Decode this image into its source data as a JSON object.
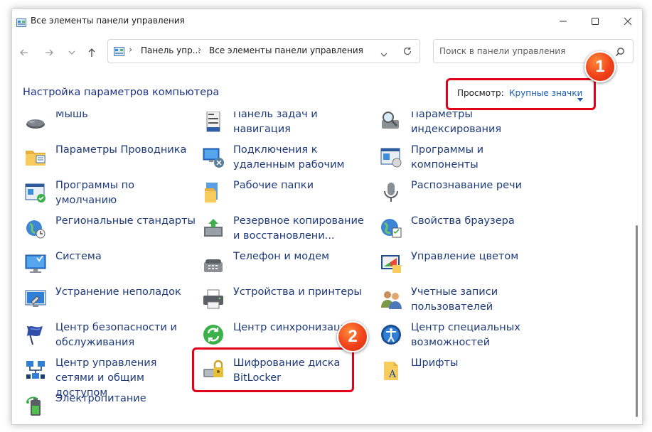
{
  "window": {
    "title": "Все элементы панели управления"
  },
  "address_bar": {
    "segments": [
      "Панель упр...",
      "Все элементы панели управления"
    ]
  },
  "search": {
    "placeholder": "Поиск в панели управления"
  },
  "header": {
    "title": "Настройка параметров компьютера",
    "view_label": "Просмотр:",
    "view_value": "Крупные значки"
  },
  "items": {
    "col1": [
      {
        "label": "Мышь",
        "icon": "mouse-icon"
      },
      {
        "label": "Параметры Проводника",
        "icon": "folder-options-icon"
      },
      {
        "label": "Программы по умолчанию",
        "icon": "default-programs-icon"
      },
      {
        "label": "Региональные стандарты",
        "icon": "region-globe-icon"
      },
      {
        "label": "Система",
        "icon": "system-monitor-icon"
      },
      {
        "label": "Устранение неполадок",
        "icon": "troubleshooting-icon"
      },
      {
        "label": "Центр безопасности и обслуживания",
        "icon": "security-flag-icon"
      },
      {
        "label": "Центр управления сетями и общим доступом",
        "icon": "network-icon"
      },
      {
        "label": "Электропитание",
        "icon": "power-battery-icon"
      }
    ],
    "col2": [
      {
        "label": "Панель задач и навигация",
        "icon": "taskbar-icon"
      },
      {
        "label": "Подключения к удаленным рабочим",
        "icon": "remote-desktop-icon"
      },
      {
        "label": "Рабочие папки",
        "icon": "work-folders-icon"
      },
      {
        "label": "Резервное копирование и восстановлени...",
        "icon": "backup-restore-icon"
      },
      {
        "label": "Телефон и модем",
        "icon": "phone-modem-icon"
      },
      {
        "label": "Устройства и принтеры",
        "icon": "printer-icon"
      },
      {
        "label": "Центр синхронизации",
        "icon": "sync-center-icon"
      },
      {
        "label": "Шифрование диска BitLocker",
        "icon": "bitlocker-icon"
      }
    ],
    "col3": [
      {
        "label": "Параметры индексирования",
        "icon": "indexing-icon"
      },
      {
        "label": "Программы и компоненты",
        "icon": "programs-features-icon"
      },
      {
        "label": "Распознавание речи",
        "icon": "microphone-icon"
      },
      {
        "label": "Свойства браузера",
        "icon": "internet-options-icon"
      },
      {
        "label": "Управление цветом",
        "icon": "color-management-icon"
      },
      {
        "label": "Учетные записи пользователей",
        "icon": "user-accounts-icon"
      },
      {
        "label": "Центр специальных возможностей",
        "icon": "ease-of-access-icon"
      },
      {
        "label": "Шрифты",
        "icon": "fonts-folder-icon"
      }
    ]
  },
  "annotations": {
    "badge1": "1",
    "badge2": "2"
  },
  "colors": {
    "link": "#1e3a7b",
    "title": "#1e3287",
    "highlight": "#e0001a",
    "badge": "#f0421b"
  }
}
